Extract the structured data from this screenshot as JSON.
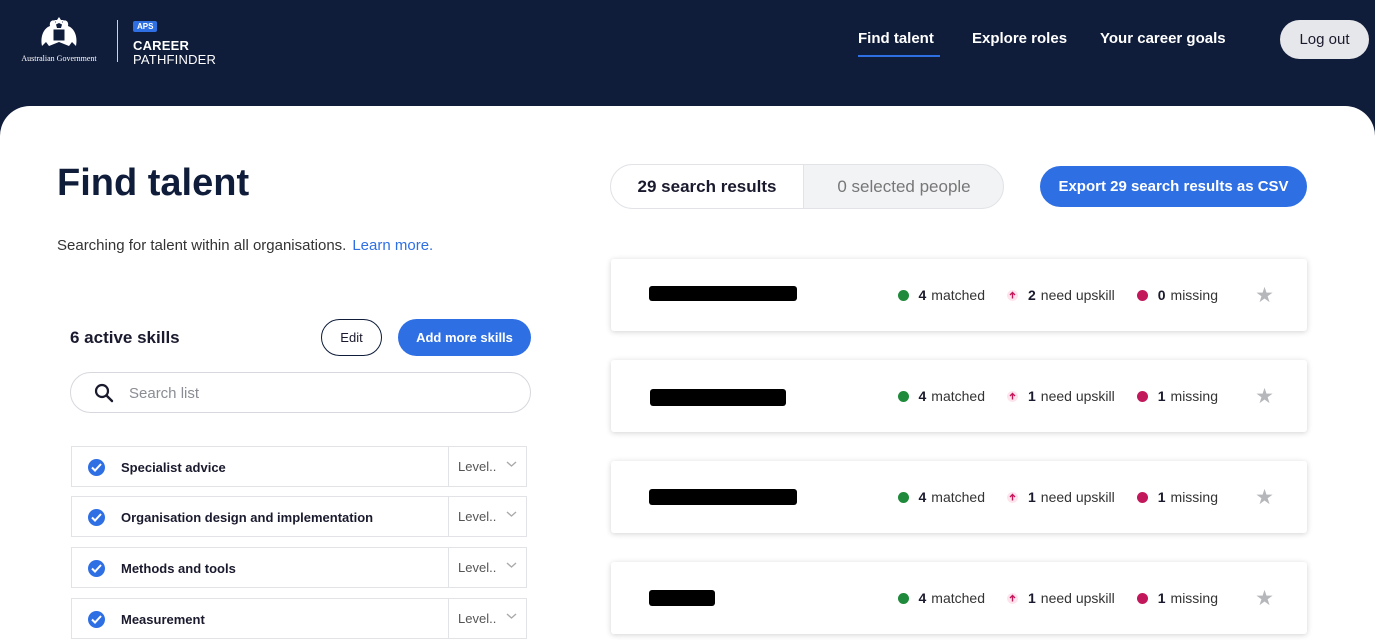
{
  "header": {
    "gov_label": "Australian Government",
    "badge": "APS",
    "brand_line1": "CAREER",
    "brand_line2": "PATHFINDER",
    "nav": [
      "Find talent",
      "Explore roles",
      "Your career goals"
    ],
    "logout": "Log out"
  },
  "page": {
    "title": "Find talent",
    "intro": "Searching for talent within all organisations.",
    "learn_more": "Learn more."
  },
  "skills": {
    "count_label": "6 active skills",
    "edit_label": "Edit",
    "add_label": "Add more skills",
    "search_placeholder": "Search list",
    "items": [
      {
        "label": "Specialist advice",
        "level": "Level.."
      },
      {
        "label": "Organisation design and implementation",
        "level": "Level.."
      },
      {
        "label": "Methods and tools",
        "level": "Level.."
      },
      {
        "label": "Measurement",
        "level": "Level.."
      }
    ]
  },
  "results": {
    "tab_results": "29 search results",
    "tab_selected": "0 selected people",
    "export_label": "Export 29 search results as CSV",
    "cards": [
      {
        "matched": "4",
        "upskill": "2",
        "missing": "0"
      },
      {
        "matched": "4",
        "upskill": "1",
        "missing": "1"
      },
      {
        "matched": "4",
        "upskill": "1",
        "missing": "1"
      },
      {
        "matched": "4",
        "upskill": "1",
        "missing": "1"
      }
    ],
    "matched_text": "matched",
    "upskill_text": "need upskill",
    "missing_text": "missing"
  },
  "colors": {
    "navy": "#0f1c3a",
    "accent": "#2f6fe4",
    "matched": "#1f8a3b",
    "missing": "#c2185b"
  }
}
